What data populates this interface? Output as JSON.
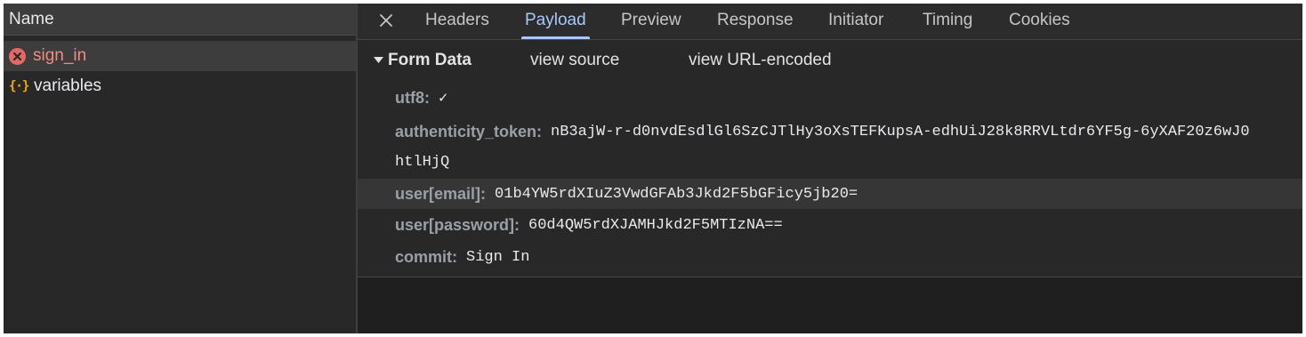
{
  "left": {
    "header": "Name",
    "requests": [
      {
        "name": "sign_in",
        "status": "error"
      },
      {
        "name": "variables",
        "status": "normal"
      }
    ]
  },
  "tabs": [
    "Headers",
    "Payload",
    "Preview",
    "Response",
    "Initiator",
    "Timing",
    "Cookies"
  ],
  "active_tab": "Payload",
  "payload": {
    "section_title": "Form Data",
    "view_source": "view source",
    "view_url_encoded": "view URL-encoded",
    "fields": [
      {
        "key": "utf8:",
        "value": "✓"
      },
      {
        "key": "authenticity_token:",
        "value": "nB3ajW-r-d0nvdEsdlGl6SzCJTlHy3oXsTEFKupsA-edhUiJ28k8RRVLtdr6YF5g-6yXAF20z6wJ0",
        "continuation": "htlHjQ"
      },
      {
        "key": "user[email]:",
        "value": "01b4YW5rdXIuZ3VwdGFAb3Jkd2F5bGFicy5jb20="
      },
      {
        "key": "user[password]:",
        "value": "60d4QW5rdXJAMHJkd2F5MTIzNA=="
      },
      {
        "key": "commit:",
        "value": "Sign In"
      }
    ]
  },
  "colors": {
    "accent": "#a8c7fa",
    "error": "#e46962",
    "panel": "#282828"
  },
  "icons": {
    "error": "error-circle-icon",
    "variables": "braces-icon",
    "close": "close-icon",
    "collapse": "triangle-down-icon"
  }
}
